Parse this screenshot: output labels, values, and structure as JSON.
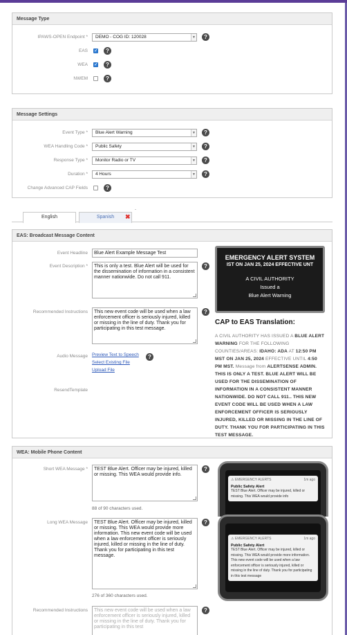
{
  "message_type": {
    "header": "Message Type",
    "endpoint_label": "IPAWS-OPEN Endpoint *",
    "endpoint_value": "DEMO - COG ID: 120028",
    "eas_label": "EAS",
    "wea_label": "WEA",
    "nwem_label": "NWEM"
  },
  "message_settings": {
    "header": "Message Settings",
    "event_type_label": "Event Type *",
    "event_type_value": "Blue Alert Warning",
    "wea_handling_label": "WEA Handling Code *",
    "wea_handling_value": "Public Safety",
    "response_type_label": "Response Type *",
    "response_type_value": "Monitor Radio or TV",
    "duration_label": "Duration *",
    "duration_value": "4 Hours",
    "advanced_cap_label": "Change Advanced CAP Fields"
  },
  "tabs": {
    "english": "English",
    "spanish": "Spanish",
    "close": "✖",
    "dot": "-"
  },
  "eas": {
    "header": "EAS: Broadcast Message Content",
    "headline_label": "Event Headline",
    "headline_value": "Blue Alert Example Message Test",
    "description_label": "Event Description *",
    "description_value": "This is only a test.  Blue Alert will be used for the dissemination of information in a consistent manner nationwide. Do not call 911.",
    "instructions_label": "Recommended Instructions",
    "instructions_value": "This new event code will be used when a law enforcement officer is seriously injured, killed or missing in the line of duty. Thank you for participating in this test message.",
    "audio_label": "Audio Message",
    "audio_link1": "Preview Text to Speech",
    "audio_link2": "Select Existing File",
    "audio_link3": "Upload File",
    "resend_label": "ResendTemplate",
    "preview_line1": "EMERGENCY ALERT SYSTEM",
    "preview_line2": "IST ON JAN 25, 2024 EFFECTIVE UNT",
    "preview_line3": "A CIVIL AUTHORITY",
    "preview_line4": "Issued a",
    "preview_line5": "Blue Alert Warning",
    "translation_title": "CAP to EAS Translation:",
    "translation": {
      "p1": "A CIVIL AUTHORITY HAS ISSUED A ",
      "b1": "BLUE ALERT WARNING",
      "p2": " FOR THE FOLLOWING COUNTIES/AREAS: ",
      "b2": "IDAHO: ADA",
      "p3": " AT ",
      "b3": "12:50 PM MST ON JAN 25, 2024",
      "p4": " EFFECTIVE UNTIL ",
      "b4": "4:50 PM MST.",
      "p5": " Message from ",
      "b5": "ALERTSENSE ADMIN. THIS IS ONLY A TEST. BLUE ALERT WILL BE USED FOR THE DISSEMINATION OF INFORMATION IN A CONSISTENT MANNER NATIONWIDE. DO NOT CALL 911.. THIS NEW EVENT CODE WILL BE USED WHEN A LAW ENFORCEMENT OFFICER IS SERIOUSLY INJURED, KILLED OR MISSING IN THE LINE OF DUTY. THANK YOU FOR PARTICIPATING IN THIS TEST MESSAGE."
    }
  },
  "wea": {
    "header": "WEA: Mobile Phone Content",
    "short_label": "Short WEA Message *",
    "short_value": "TEST Blue Alert. Officer may be injured, killed or missing. This WEA would provide info.",
    "short_counter": "88 of 90 characters used.",
    "long_label": "Long WEA Message",
    "long_value": "TEST Blue Alert. Officer may be injured, killed or missing. This WEA would provide more information. This new event code will be used when a law enforcement officer is seriously injured, killed or missing in the line of duty. Thank you for participating in this test message.",
    "long_counter": "276 of 360 characters used.",
    "rec_label": "Recommended Instructions",
    "rec_value": "This new event code will be used when a law enforcement officer is seriously injured, killed or missing in the line of duty. Thank you for participating in this test",
    "phone1": {
      "app": "EMERGENCY ALERTS",
      "time": "1m ago",
      "title": "Public Safety Alert",
      "body": "TEST Blue Alert. Officer may be injured, killed or missing. This WEA would provide info"
    },
    "phone2": {
      "app": "EMERGENCY ALERTS",
      "time": "1m ago",
      "title": "Public Safety Alert",
      "body": "TEST Blue Alert. Officer may be injured, killed or missing. This WEA would provide more information. This new event code will be used when a law enforcement officer is seriously injured, killed or missing in the line of duty. Thank you for participating in this test message"
    }
  },
  "help_glyph": "?",
  "colors": {
    "accent": "#5b3c97",
    "checkbox": "#2f7fd9",
    "link": "#2a56b8",
    "close": "#e0332f"
  }
}
